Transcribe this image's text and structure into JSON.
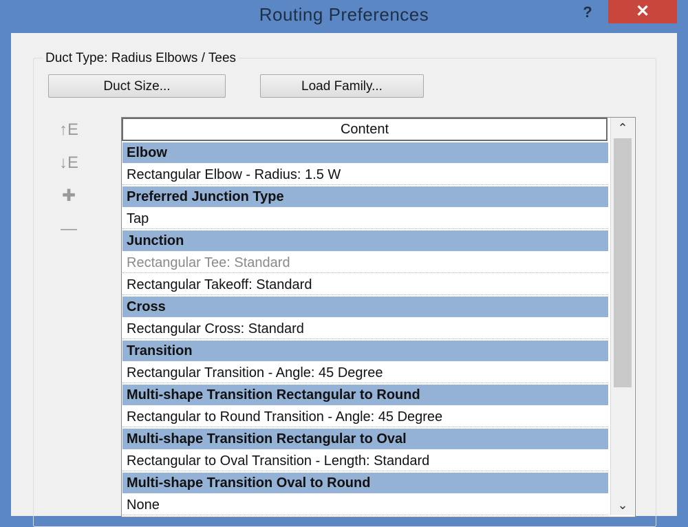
{
  "window": {
    "title": "Routing Preferences",
    "help_label": "?",
    "close_label": "✕"
  },
  "dialog": {
    "group_label": "Duct Type: Radius Elbows / Tees",
    "duct_size_button": "Duct Size...",
    "load_family_button": "Load Family..."
  },
  "side_toolbar": {
    "move_up_icon": "↑E",
    "move_down_icon": "↓E",
    "add_icon": "✚",
    "remove_icon": "—"
  },
  "grid": {
    "column_header": "Content",
    "rows": [
      {
        "text": "Elbow",
        "kind": "header"
      },
      {
        "text": "Rectangular Elbow - Radius: 1.5 W",
        "kind": "item"
      },
      {
        "text": "Preferred Junction Type",
        "kind": "header"
      },
      {
        "text": "Tap",
        "kind": "item"
      },
      {
        "text": "Junction",
        "kind": "header"
      },
      {
        "text": "Rectangular Tee: Standard",
        "kind": "item-dim"
      },
      {
        "text": "Rectangular Takeoff: Standard",
        "kind": "item"
      },
      {
        "text": "Cross",
        "kind": "header"
      },
      {
        "text": "Rectangular Cross: Standard",
        "kind": "item"
      },
      {
        "text": "Transition",
        "kind": "header"
      },
      {
        "text": "Rectangular Transition - Angle: 45 Degree",
        "kind": "item"
      },
      {
        "text": "Multi-shape Transition Rectangular to Round",
        "kind": "header"
      },
      {
        "text": "Rectangular to Round Transition - Angle: 45 Degree",
        "kind": "item"
      },
      {
        "text": "Multi-shape Transition Rectangular to Oval",
        "kind": "header"
      },
      {
        "text": "Rectangular to Oval Transition - Length: Standard",
        "kind": "item"
      },
      {
        "text": "Multi-shape Transition Oval to Round",
        "kind": "header"
      },
      {
        "text": "None",
        "kind": "item"
      }
    ],
    "scroll_up_icon": "⌃",
    "scroll_down_icon": "⌄"
  },
  "colors": {
    "title_bar": "#5b87c4",
    "close_button": "#c9463d",
    "section_header": "#94b1d6"
  }
}
